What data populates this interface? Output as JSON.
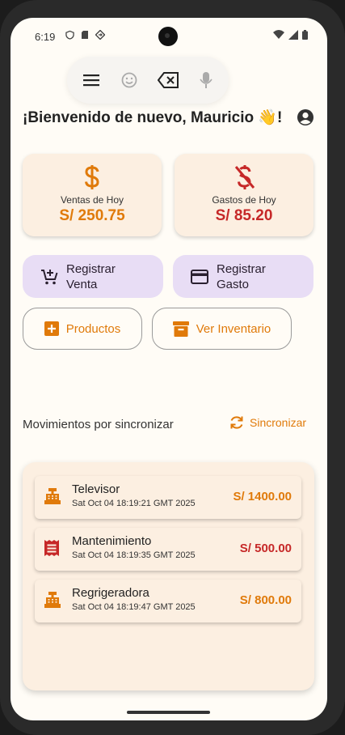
{
  "status_bar": {
    "time": "6:19"
  },
  "greeting": "¡Bienvenido de nuevo, Mauricio 👋!",
  "summary": [
    {
      "label": "Ventas de Hoy",
      "value": "S/ 250.75",
      "color": "#e07a0a",
      "icon": "dollar-icon"
    },
    {
      "label": "Gastos de Hoy",
      "value": "S/ 85.20",
      "color": "#c62828",
      "icon": "money-off-icon"
    }
  ],
  "actions": {
    "register_sale": "Registrar Venta",
    "register_expense": "Registrar Gasto",
    "products": "Productos",
    "inventory": "Ver Inventario"
  },
  "pending": {
    "title": "Movimientos por sincronizar",
    "sync_label": "Sincronizar",
    "items": [
      {
        "name": "Televisor",
        "date": "Sat Oct 04 18:19:21 GMT 2025",
        "amount": "S/ 1400.00",
        "kind": "sale",
        "color": "#e07a0a",
        "icon": "cash-register-icon"
      },
      {
        "name": "Mantenimiento",
        "date": "Sat Oct 04 18:19:35 GMT 2025",
        "amount": "S/ 500.00",
        "kind": "expense",
        "color": "#c62828",
        "icon": "receipt-icon"
      },
      {
        "name": "Regrigeradora",
        "date": "Sat Oct 04 18:19:47 GMT 2025",
        "amount": "S/ 800.00",
        "kind": "sale",
        "color": "#e07a0a",
        "icon": "cash-register-icon"
      }
    ]
  },
  "colors": {
    "accent": "#e07a0a",
    "expense": "#c62828",
    "card_bg": "#fcefe1",
    "pill_bg": "#e8ddf5"
  }
}
